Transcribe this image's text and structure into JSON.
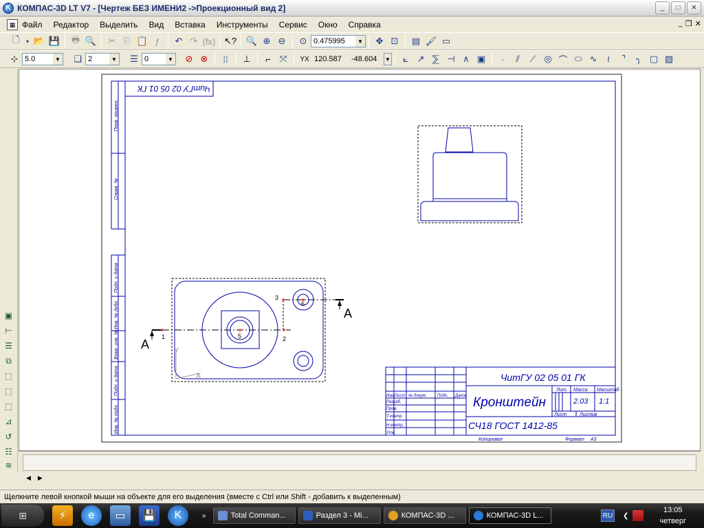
{
  "titlebar": {
    "title": "КОМПАС-3D LT V7 - [Чертеж БЕЗ ИМЕНИ2 ->Проекционный вид 2]"
  },
  "menu": [
    "Файл",
    "Редактор",
    "Выделить",
    "Вид",
    "Вставка",
    "Инструменты",
    "Сервис",
    "Окно",
    "Справка"
  ],
  "toolbar1": {
    "zoom_value": "0.475995"
  },
  "toolbar2": {
    "step_value": "5.0",
    "layer_value": "2",
    "style_value": "0",
    "coord_x": "120.587",
    "coord_y": "-48.604"
  },
  "drawing": {
    "top_stamp": "ЧитГУ 02 05 01 ГК",
    "section_label": "А",
    "points": [
      "1",
      "2",
      "3",
      "5",
      "6"
    ],
    "axis_y": "Y",
    "axis_x": "X",
    "side_labels": [
      "Перв. примен.",
      "Справ. №",
      "Подп. и дата",
      "Инв. № дубл.",
      "Взам. инв. №",
      "Подп. и дата",
      "Инв. № подл."
    ],
    "stamp": {
      "designation": "ЧитГУ 02 05 01 ГК",
      "name": "Кронштейн",
      "material": "СЧ18 ГОСТ 1412-85",
      "col_lit": "Лит.",
      "col_mass": "Масса",
      "col_scale": "Масштаб",
      "mass": "2.03",
      "scale": "1:1",
      "sheet": "Лист",
      "sheets": "Листов",
      "copied": "Копировал",
      "format_label": "Формат",
      "format": "А3",
      "rows": [
        "Изм.",
        "Лист",
        "№ докум.",
        "Подп.",
        "Дата",
        "Разраб.",
        "Пров.",
        "Т.контр.",
        "Н.контр.",
        "Утв."
      ]
    }
  },
  "statusbar": {
    "text": "Щелкните левой кнопкой мыши на объекте для его выделения (вместе с Ctrl или Shift - добавить к выделенным)"
  },
  "taskbar": {
    "tasks": [
      "Total Comman...",
      "Раздел 3 - Mi...",
      "КОМПАС-3D ...",
      "КОМПАС-3D L..."
    ],
    "lang": "RU",
    "time": "13:05",
    "day": "четверг"
  }
}
